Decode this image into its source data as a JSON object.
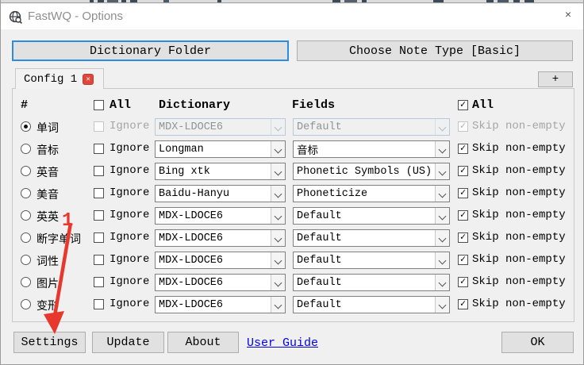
{
  "window": {
    "title": "FastWQ - Options"
  },
  "icons": {
    "close": "✕",
    "tab_close": "✕",
    "plus": "+"
  },
  "toolbar": {
    "dictionary_folder": "Dictionary Folder",
    "choose_note_type": "Choose Note Type [Basic]"
  },
  "tabs": {
    "config1": "Config 1"
  },
  "table": {
    "headers": {
      "num": "#",
      "all_left": "All",
      "dictionary": "Dictionary",
      "fields": "Fields",
      "all_right": "All"
    },
    "ignore_label": "Ignore",
    "skip_label": "Skip non-empty",
    "rows": [
      {
        "label": "单词",
        "dict": "MDX-LDOCE6",
        "field": "Default",
        "selected": true,
        "disabled": true
      },
      {
        "label": "音标",
        "dict": "Longman",
        "field": "音标"
      },
      {
        "label": "英音",
        "dict": "Bing xtk",
        "field": "Phonetic Symbols (US)"
      },
      {
        "label": "美音",
        "dict": "Baidu-Hanyu",
        "field": "Phoneticize"
      },
      {
        "label": "英英",
        "dict": "MDX-LDOCE6",
        "field": "Default"
      },
      {
        "label": "断字单词",
        "dict": "MDX-LDOCE6",
        "field": "Default"
      },
      {
        "label": "词性",
        "dict": "MDX-LDOCE6",
        "field": "Default"
      },
      {
        "label": "图片",
        "dict": "MDX-LDOCE6",
        "field": "Default"
      },
      {
        "label": "变形",
        "dict": "MDX-LDOCE6",
        "field": "Default"
      }
    ]
  },
  "footer": {
    "settings": "Settings",
    "update": "Update",
    "about": "About",
    "user_guide": "User Guide",
    "ok": "OK"
  },
  "annotation": {
    "step_label": "1",
    "color": "#e8382d"
  },
  "colors": {
    "accent_focus": "#2b8ce0",
    "link": "#0000ee",
    "tab_close_red": "#e0473c",
    "annotation_red": "#e8382d"
  }
}
